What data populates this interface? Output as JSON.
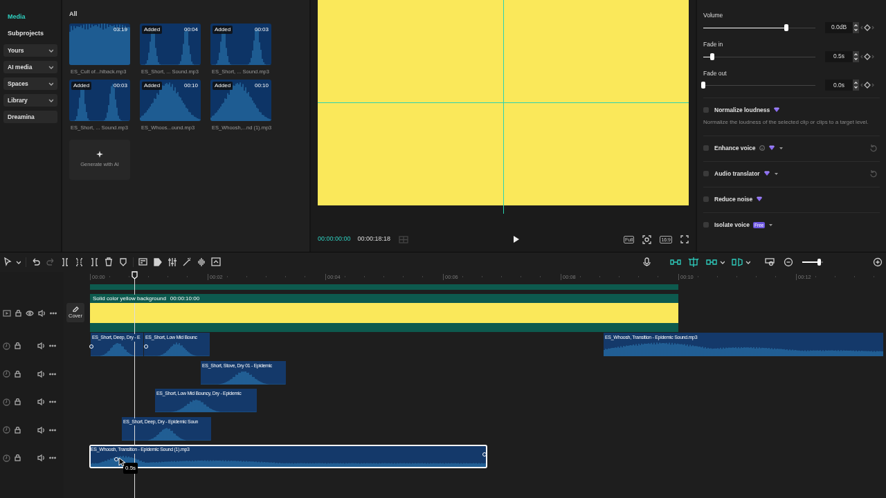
{
  "sidebar": {
    "items": [
      {
        "label": "Media",
        "kind": "link",
        "selected": true
      },
      {
        "label": "Subprojects",
        "kind": "link",
        "selected": false
      },
      {
        "label": "Yours",
        "kind": "group",
        "selected": false
      },
      {
        "label": "AI media",
        "kind": "group",
        "selected": false
      },
      {
        "label": "Spaces",
        "kind": "group",
        "selected": false
      },
      {
        "label": "Library",
        "kind": "group",
        "selected": false
      },
      {
        "label": "Dreamina",
        "kind": "plain",
        "selected": false
      }
    ]
  },
  "media": {
    "filter": "All",
    "items": [
      {
        "name": "ES_Cult of...hlback.mp3",
        "duration": "03:19"
      },
      {
        "name": "ES_Short, ... Sound.mp3",
        "duration": "00:04",
        "badge": "Added"
      },
      {
        "name": "ES_Short, ... Sound.mp3",
        "duration": "00:03",
        "badge": "Added"
      },
      {
        "name": "ES_Short, ... Sound.mp3",
        "duration": "00:03",
        "badge": "Added"
      },
      {
        "name": "ES_Whoos...ound.mp3",
        "duration": "00:10",
        "badge": "Added"
      },
      {
        "name": "ES_Whoosh,...nd (1).mp3",
        "duration": "00:10",
        "badge": "Added"
      }
    ],
    "generate": "Generate with AI"
  },
  "preview": {
    "current_time": "00:00:00:00",
    "total_time": "00:00:18:18",
    "buttons": [
      "Full",
      "16:9"
    ]
  },
  "audio_panel": {
    "sliders": [
      {
        "label": "Volume",
        "level": 0.74,
        "value": "0.0dB"
      },
      {
        "label": "Fade in",
        "level": 0.08,
        "value": "0.5s"
      },
      {
        "label": "Fade out",
        "level": 0,
        "value": "0.0s"
      }
    ],
    "options": [
      {
        "label": "Normalize loudness",
        "checked": false,
        "premium": true,
        "description": "Normalize the loudness of the selected clip or clips to a target level.",
        "info": false,
        "dropdown": false,
        "reset": false
      },
      {
        "label": "Enhance voice",
        "checked": false,
        "premium": true,
        "info": true,
        "dropdown": true,
        "reset": true
      },
      {
        "label": "Audio translator",
        "checked": false,
        "premium": true,
        "info": false,
        "dropdown": true,
        "reset": true
      },
      {
        "label": "Reduce noise",
        "checked": false,
        "premium": true,
        "info": false,
        "dropdown": false,
        "reset": false
      },
      {
        "label": "Isolate voice",
        "checked": false,
        "premium": false,
        "badge": "Free",
        "info": false,
        "dropdown": true,
        "reset": false
      }
    ]
  },
  "timeline": {
    "zoom": {
      "level": 0.8
    },
    "ruler": [
      "00:00",
      "00:02",
      "00:04",
      "00:06",
      "00:08",
      "00:10",
      "00:12"
    ],
    "main_track": {
      "clip_title": "Solid color yellow background",
      "clip_duration": "00:00:10:00",
      "cover": "Cover"
    },
    "audio_tracks": [
      {
        "clips": [
          {
            "title": "ES_Short, Deep, Dry - E",
            "selected": false
          },
          {
            "title": "ES_Short, Low Mid Bounc",
            "selected": false
          },
          {
            "title": "ES_Whoosh, Transition - Epidemic Sound.mp3",
            "selected": false
          }
        ]
      },
      {
        "clips": [
          {
            "title": "ES_Short, Stove, Dry 01 - Epidemic",
            "selected": false
          }
        ]
      },
      {
        "clips": [
          {
            "title": "ES_Short, Low Mid Bouncy, Dry - Epidemic",
            "selected": false
          }
        ]
      },
      {
        "clips": [
          {
            "title": "ES_Short, Deep, Dry - Epidemic Soun",
            "selected": false
          }
        ]
      },
      {
        "clips": [
          {
            "title": "ES_Whoosh, Transition - Epidemic Sound (1).mp3",
            "selected": true
          }
        ]
      }
    ],
    "tooltip": "0.5s"
  }
}
